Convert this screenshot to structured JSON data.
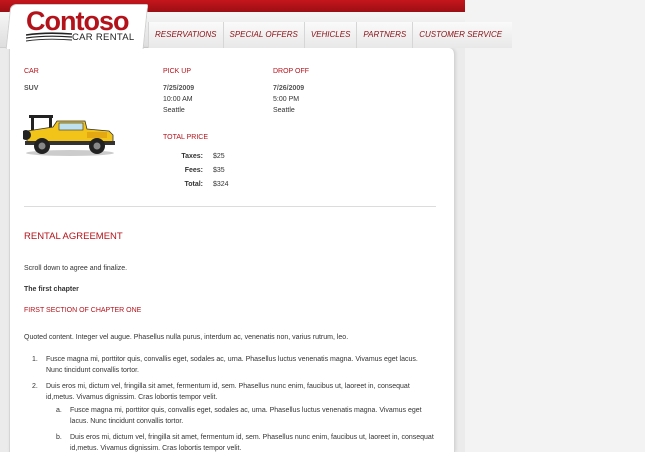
{
  "brand": {
    "logo_text": "Contoso",
    "logo_subtitle": "CAR RENTAL",
    "accent_color": "#b3121a"
  },
  "nav": {
    "items": [
      {
        "label": "Reservations"
      },
      {
        "label": "Special Offers"
      },
      {
        "label": "Vehicles"
      },
      {
        "label": "Partners"
      },
      {
        "label": "Customer Service"
      }
    ]
  },
  "booking": {
    "car_label": "CAR",
    "car_type": "SUV",
    "car_icon": "jeep-image",
    "pickup": {
      "label": "PICK UP",
      "date": "7/25/2009",
      "time": "10:00  AM",
      "city": "Seattle"
    },
    "dropoff": {
      "label": "DROP OFF",
      "date": "7/26/2009",
      "time": "5:00  PM",
      "city": "Seattle"
    },
    "total_price_label": "TOTAL PRICE",
    "prices": [
      {
        "label": "Taxes:",
        "value": "$25"
      },
      {
        "label": "Fees:",
        "value": "$35"
      },
      {
        "label": "Total:",
        "value": "$324"
      }
    ]
  },
  "agreement": {
    "title": "RENTAL AGREEMENT",
    "scroll_text": "Scroll down to agree and finalize.",
    "chapter_title": "The first chapter",
    "section_title": "FIRST SECTION OF CHAPTER ONE",
    "quoted": "Quoted content. Integer vel augue. Phasellus nulla purus, interdum ac, venenatis non, varius rutrum, leo.",
    "list": [
      {
        "num": "1.",
        "text": "Fusce magna mi, porttitor quis, convallis eget, sodales ac, urna. Phasellus luctus venenatis magna. Vivamus eget lacus. Nunc tincidunt convallis tortor."
      },
      {
        "num": "2.",
        "text": "Duis eros mi, dictum vel, fringilla sit amet, fermentum id, sem. Phasellus nunc enim, faucibus ut, laoreet in, consequat id,metus. Vivamus dignissim. Cras lobortis tempor velit.",
        "sub": [
          {
            "num": "a.",
            "text": "Fusce magna mi, porttitor quis, convallis eget, sodales ac, urna. Phasellus luctus venenatis magna. Vivamus eget lacus. Nunc tincidunt convallis tortor."
          },
          {
            "num": "b.",
            "text": "Duis eros mi, dictum vel, fringilla sit amet, fermentum id, sem. Phasellus nunc enim, faucibus ut, laoreet in, consequat id,metus. Vivamus dignissim. Cras lobortis tempor velit."
          }
        ]
      }
    ]
  }
}
